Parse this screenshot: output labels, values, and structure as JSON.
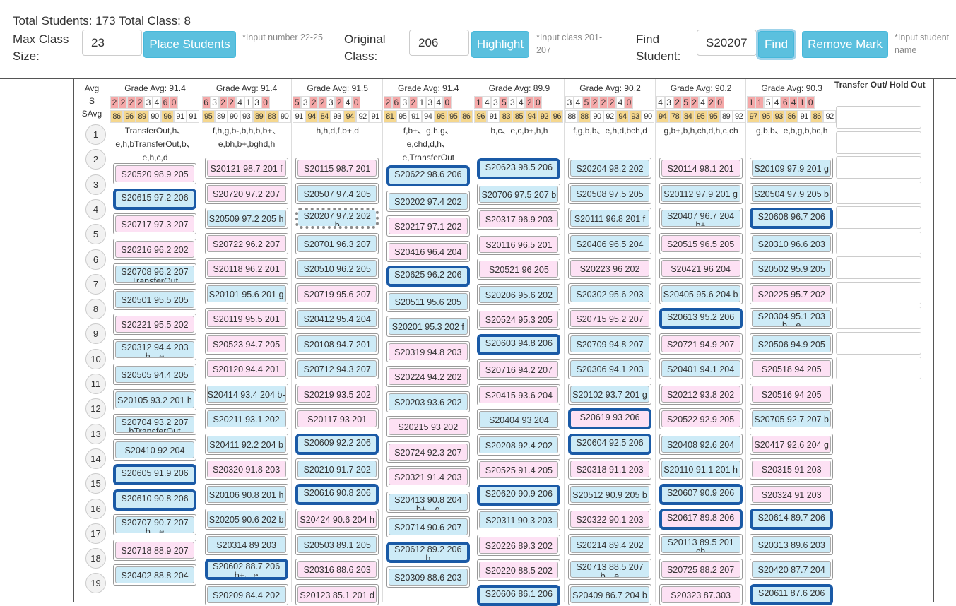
{
  "header": {
    "totals": "Total Students: 173 Total Class: 8",
    "max_class_label": "Max Class Size:",
    "max_class_value": "23",
    "place_button": "Place Students",
    "place_hint": "*Input number 22-25",
    "original_label": "Original Class:",
    "original_value": "206",
    "highlight_button": "Highlight",
    "highlight_hint": "*Input class 201-207",
    "find_label": "Find Student:",
    "find_value": "S20207",
    "find_button": "Find",
    "remove_button": "Remove Mark",
    "find_hint": "*Input student name"
  },
  "rows": {
    "avg_label": "Avg",
    "s_label": "S",
    "savg_label": "SAvg",
    "numbers": [
      "1",
      "2",
      "3",
      "4",
      "5",
      "6",
      "7",
      "8",
      "9",
      "10",
      "11",
      "12",
      "13",
      "14",
      "15",
      "16",
      "17",
      "18",
      "19"
    ]
  },
  "transfer_title": "Transfer Out/ Hold Out",
  "columns": [
    {
      "avg": "Grade Avg: 91.4",
      "s": [
        [
          "2",
          1
        ],
        [
          "2",
          1
        ],
        [
          "2",
          1
        ],
        [
          "2",
          1
        ],
        [
          "3",
          0
        ],
        [
          "4",
          0
        ],
        [
          "6",
          1
        ],
        [
          "0",
          1
        ]
      ],
      "savg": [
        [
          "86",
          1
        ],
        [
          "96",
          1
        ],
        [
          "89",
          1
        ],
        [
          "90",
          0
        ],
        [
          "96",
          1
        ],
        [
          "91",
          0
        ],
        [
          "91",
          0
        ]
      ],
      "tags": "TransferOut,h、e,h,bTransferOut,b、e,h,c,d",
      "students": [
        {
          "t": "S20520 98.9 205",
          "c": "p"
        },
        {
          "t": "S20615 97.2 206",
          "c": "b",
          "hl": true
        },
        {
          "t": "S20717 97.3 207",
          "c": "p"
        },
        {
          "t": "S20216 96.2 202",
          "c": "p"
        },
        {
          "t": "S20708 96.2 207",
          "t2": "TransferOut",
          "c": "b"
        },
        {
          "t": "S20501 95.5 205",
          "c": "b"
        },
        {
          "t": "S20221 95.5 202",
          "c": "p"
        },
        {
          "t": "S20312 94.4 203",
          "t2": "h、e",
          "c": "b"
        },
        {
          "t": "S20505 94.4 205",
          "c": "b"
        },
        {
          "t": "S20105 93.2 201 h",
          "c": "b"
        },
        {
          "t": "S20704 93.2 207",
          "t2": "bTransferOut",
          "c": "b"
        },
        {
          "t": "S20410 92 204",
          "c": "b"
        },
        {
          "t": "S20605 91.9 206",
          "c": "b",
          "hl": true
        },
        {
          "t": "S20610 90.8 206",
          "c": "b",
          "hl": true
        },
        {
          "t": "S20707 90.7 207",
          "t2": "b、e",
          "c": "b"
        },
        {
          "t": "S20718 88.9 207",
          "c": "p"
        },
        {
          "t": "S20402 88.8 204",
          "c": "b"
        }
      ]
    },
    {
      "avg": "Grade Avg: 91.4",
      "s": [
        [
          "6",
          1
        ],
        [
          "3",
          0
        ],
        [
          "2",
          1
        ],
        [
          "2",
          1
        ],
        [
          "4",
          0
        ],
        [
          "1",
          0
        ],
        [
          "3",
          0
        ],
        [
          "0",
          1
        ]
      ],
      "savg": [
        [
          "95",
          1
        ],
        [
          "89",
          0
        ],
        [
          "90",
          0
        ],
        [
          "93",
          0
        ],
        [
          "89",
          1
        ],
        [
          "88",
          1
        ],
        [
          "90",
          0
        ]
      ],
      "tags": "f,h,g,b-,b,h,b,b+、e,bh,b+,bghd,h",
      "students": [
        {
          "t": "S20121 98.7 201 f",
          "c": "p"
        },
        {
          "t": "S20720 97.2 207",
          "c": "p"
        },
        {
          "t": "S20509 97.2 205 h",
          "c": "b"
        },
        {
          "t": "S20722 96.2 207",
          "c": "p"
        },
        {
          "t": "S20118 96.2 201",
          "c": "p"
        },
        {
          "t": "S20101 95.6 201 g",
          "c": "b"
        },
        {
          "t": "S20119 95.5 201",
          "c": "p"
        },
        {
          "t": "S20523 94.7 205",
          "c": "p"
        },
        {
          "t": "S20120 94.4 201",
          "c": "p"
        },
        {
          "t": "S20414 93.4 204 b-",
          "c": "b"
        },
        {
          "t": "S20211 93.1 202",
          "c": "b"
        },
        {
          "t": "S20411 92.2 204 b",
          "c": "b"
        },
        {
          "t": "S20320 91.8 203",
          "c": "p"
        },
        {
          "t": "S20106 90.8 201 h",
          "c": "b"
        },
        {
          "t": "S20205 90.6 202 b",
          "c": "b"
        },
        {
          "t": "S20314 89 203",
          "c": "b"
        },
        {
          "t": "S20602 88.7 206",
          "t2": "b+、e",
          "c": "b",
          "hl": true
        },
        {
          "t": "S20209 84.4 202",
          "c": "b"
        }
      ]
    },
    {
      "avg": "Grade Avg: 91.5",
      "s": [
        [
          "5",
          1
        ],
        [
          "3",
          0
        ],
        [
          "2",
          1
        ],
        [
          "2",
          1
        ],
        [
          "3",
          0
        ],
        [
          "2",
          1
        ],
        [
          "4",
          0
        ],
        [
          "0",
          1
        ]
      ],
      "savg": [
        [
          "91",
          0
        ],
        [
          "94",
          1
        ],
        [
          "84",
          1
        ],
        [
          "93",
          0
        ],
        [
          "94",
          1
        ],
        [
          "92",
          0
        ],
        [
          "91",
          0
        ]
      ],
      "tags": "h,h,d,f,b+,d",
      "students": [
        {
          "t": "S20115 98.7 201",
          "c": "p"
        },
        {
          "t": "S20507 97.4 205",
          "c": "b"
        },
        {
          "t": "S20207 97.2 202",
          "t2": "b",
          "c": "b",
          "dot": true
        },
        {
          "t": "S20701 96.3 207",
          "c": "b"
        },
        {
          "t": "S20510 96.2 205",
          "c": "b"
        },
        {
          "t": "S20719 95.6 207",
          "c": "p"
        },
        {
          "t": "S20412 95.4 204",
          "c": "b"
        },
        {
          "t": "S20108 94.7 201",
          "c": "b"
        },
        {
          "t": "S20712 94.3 207",
          "c": "b"
        },
        {
          "t": "S20219 93.5 202",
          "c": "p"
        },
        {
          "t": "S20117 93 201",
          "c": "p"
        },
        {
          "t": "S20609 92.2 206",
          "c": "b",
          "hl": true
        },
        {
          "t": "S20210 91.7 202",
          "c": "b"
        },
        {
          "t": "S20616 90.8 206",
          "c": "b",
          "hl": true
        },
        {
          "t": "S20424 90.6 204 h",
          "c": "p"
        },
        {
          "t": "S20503 89.1 205",
          "c": "b"
        },
        {
          "t": "S20316 88.6 203",
          "c": "p"
        },
        {
          "t": "S20123 85.1 201 d",
          "c": "p"
        }
      ]
    },
    {
      "avg": "Grade Avg: 91.4",
      "s": [
        [
          "2",
          1
        ],
        [
          "6",
          1
        ],
        [
          "3",
          0
        ],
        [
          "2",
          1
        ],
        [
          "1",
          0
        ],
        [
          "3",
          0
        ],
        [
          "4",
          0
        ],
        [
          "0",
          1
        ]
      ],
      "savg": [
        [
          "81",
          1
        ],
        [
          "95",
          0
        ],
        [
          "91",
          0
        ],
        [
          "94",
          0
        ],
        [
          "95",
          1
        ],
        [
          "95",
          1
        ],
        [
          "86",
          1
        ]
      ],
      "tags": "f,b+、g,h,g、e,chd,d,h、e,TransferOut",
      "students": [
        {
          "t": "S20622 98.6 206",
          "c": "b",
          "hl": true
        },
        {
          "t": "S20202 97.4 202",
          "c": "b"
        },
        {
          "t": "S20217 97.1 202",
          "c": "p"
        },
        {
          "t": "S20416 96.4 204",
          "c": "p"
        },
        {
          "t": "S20625 96.2 206",
          "c": "b",
          "hl": true
        },
        {
          "t": "S20511 95.6 205",
          "c": "b"
        },
        {
          "t": "S20201 95.3 202 f",
          "c": "b"
        },
        {
          "t": "S20319 94.8 203",
          "c": "p"
        },
        {
          "t": "S20224 94.2 202",
          "c": "p"
        },
        {
          "t": "S20203 93.6 202",
          "c": "b"
        },
        {
          "t": "S20215 93 202",
          "c": "p"
        },
        {
          "t": "S20724 92.3 207",
          "c": "p"
        },
        {
          "t": "S20321 91.4 203",
          "c": "p"
        },
        {
          "t": "S20413 90.8 204",
          "t2": "b+、g",
          "c": "b"
        },
        {
          "t": "S20714 90.6 207",
          "c": "b"
        },
        {
          "t": "S20612 89.2 206",
          "t2": "h",
          "c": "b",
          "hl": true
        },
        {
          "t": "S20309 88.6 203",
          "c": "b"
        }
      ]
    },
    {
      "avg": "Grade Avg: 89.9",
      "s": [
        [
          "1",
          1
        ],
        [
          "4",
          0
        ],
        [
          "3",
          0
        ],
        [
          "5",
          1
        ],
        [
          "3",
          0
        ],
        [
          "4",
          0
        ],
        [
          "2",
          1
        ],
        [
          "0",
          1
        ]
      ],
      "savg": [
        [
          "96",
          1
        ],
        [
          "91",
          0
        ],
        [
          "83",
          1
        ],
        [
          "85",
          1
        ],
        [
          "94",
          1
        ],
        [
          "92",
          1
        ],
        [
          "96",
          1
        ]
      ],
      "tags": "b,c、e,c,b+,h,h",
      "students": [
        {
          "t": "S20623 98.5 206",
          "c": "b",
          "hl": true
        },
        {
          "t": "S20706 97.5 207 b",
          "c": "b"
        },
        {
          "t": "S20317 96.9 203",
          "c": "p"
        },
        {
          "t": "S20116 96.5 201",
          "c": "p"
        },
        {
          "t": "S20521 96 205",
          "c": "p"
        },
        {
          "t": "S20206 95.6 202",
          "c": "b"
        },
        {
          "t": "S20524 95.3 205",
          "c": "p"
        },
        {
          "t": "S20603 94.8 206",
          "c": "b",
          "hl": true
        },
        {
          "t": "S20716 94.2 207",
          "c": "p"
        },
        {
          "t": "S20415 93.6 204",
          "c": "p"
        },
        {
          "t": "S20404 93 204",
          "c": "b"
        },
        {
          "t": "S20208 92.4 202",
          "c": "b"
        },
        {
          "t": "S20525 91.4 205",
          "c": "p"
        },
        {
          "t": "S20620 90.9 206",
          "c": "b",
          "hl": true
        },
        {
          "t": "S20311 90.3 203",
          "c": "b"
        },
        {
          "t": "S20226 89.3 202",
          "c": "p"
        },
        {
          "t": "S20220 88.5 202",
          "c": "p"
        },
        {
          "t": "S20606 86.1 206",
          "c": "b",
          "hl": true
        }
      ]
    },
    {
      "avg": "Grade Avg: 90.2",
      "s": [
        [
          "3",
          0
        ],
        [
          "4",
          0
        ],
        [
          "5",
          1
        ],
        [
          "2",
          1
        ],
        [
          "2",
          1
        ],
        [
          "2",
          1
        ],
        [
          "4",
          0
        ],
        [
          "0",
          1
        ]
      ],
      "savg": [
        [
          "88",
          0
        ],
        [
          "88",
          1
        ],
        [
          "90",
          0
        ],
        [
          "92",
          0
        ],
        [
          "94",
          1
        ],
        [
          "93",
          1
        ],
        [
          "90",
          0
        ]
      ],
      "tags": "f,g,b,b、e,h,d,bch,d",
      "students": [
        {
          "t": "S20204 98.2 202",
          "c": "b"
        },
        {
          "t": "S20508 97.5 205",
          "c": "b"
        },
        {
          "t": "S20111 96.8 201 f",
          "c": "b"
        },
        {
          "t": "S20406 96.5 204",
          "c": "b"
        },
        {
          "t": "S20223 96 202",
          "c": "p"
        },
        {
          "t": "S20302 95.6 203",
          "c": "b"
        },
        {
          "t": "S20715 95.2 207",
          "c": "p"
        },
        {
          "t": "S20709 94.8 207",
          "c": "b"
        },
        {
          "t": "S20306 94.1 203",
          "c": "b"
        },
        {
          "t": "S20102 93.7 201 g",
          "c": "b"
        },
        {
          "t": "S20619 93 206",
          "c": "p",
          "hl": true
        },
        {
          "t": "S20604 92.5 206",
          "c": "b",
          "hl": true
        },
        {
          "t": "S20318 91.1 203",
          "c": "p"
        },
        {
          "t": "S20512 90.9 205 b",
          "c": "b"
        },
        {
          "t": "S20322 90.1 203",
          "c": "p"
        },
        {
          "t": "S20214 89.4 202",
          "c": "b"
        },
        {
          "t": "S20713 88.5 207",
          "t2": "b、e",
          "c": "b"
        },
        {
          "t": "S20409 86.7 204 b",
          "c": "b"
        }
      ]
    },
    {
      "avg": "Grade Avg: 90.2",
      "s": [
        [
          "4",
          0
        ],
        [
          "3",
          0
        ],
        [
          "2",
          1
        ],
        [
          "5",
          1
        ],
        [
          "2",
          1
        ],
        [
          "4",
          0
        ],
        [
          "2",
          1
        ],
        [
          "0",
          1
        ]
      ],
      "savg": [
        [
          "94",
          1
        ],
        [
          "78",
          1
        ],
        [
          "84",
          1
        ],
        [
          "95",
          1
        ],
        [
          "95",
          1
        ],
        [
          "89",
          0
        ],
        [
          "92",
          0
        ]
      ],
      "tags": "g,b+,b,h,ch,d,h,c,ch",
      "students": [
        {
          "t": "S20114 98.1 201",
          "c": "p"
        },
        {
          "t": "S20112 97.9 201 g",
          "c": "b"
        },
        {
          "t": "S20407 96.7 204",
          "t2": "b+",
          "c": "b"
        },
        {
          "t": "S20515 96.5 205",
          "c": "p"
        },
        {
          "t": "S20421 96 204",
          "c": "p"
        },
        {
          "t": "S20405 95.6 204 b",
          "c": "b"
        },
        {
          "t": "S20613 95.2 206",
          "c": "b",
          "hl": true
        },
        {
          "t": "S20721 94.9 207",
          "c": "p"
        },
        {
          "t": "S20401 94.1 204",
          "c": "b"
        },
        {
          "t": "S20212 93.8 202",
          "c": "p"
        },
        {
          "t": "S20522 92.9 205",
          "c": "p"
        },
        {
          "t": "S20408 92.6 204",
          "c": "b"
        },
        {
          "t": "S20110 91.1 201 h",
          "c": "b"
        },
        {
          "t": "S20607 90.9 206",
          "c": "b",
          "hl": true
        },
        {
          "t": "S20617 89.8 206",
          "c": "p",
          "hl": true
        },
        {
          "t": "S20113 89.5 201",
          "t2": "ch",
          "c": "b"
        },
        {
          "t": "S20725 88.2 207",
          "c": "p"
        },
        {
          "t": "S20323 87.303",
          "c": "p"
        }
      ]
    },
    {
      "avg": "Grade Avg: 90.3",
      "s": [
        [
          "1",
          1
        ],
        [
          "1",
          1
        ],
        [
          "5",
          0
        ],
        [
          "4",
          0
        ],
        [
          "6",
          1
        ],
        [
          "4",
          1
        ],
        [
          "1",
          1
        ],
        [
          "0",
          1
        ]
      ],
      "savg": [
        [
          "97",
          1
        ],
        [
          "95",
          1
        ],
        [
          "93",
          1
        ],
        [
          "86",
          1
        ],
        [
          "91",
          0
        ],
        [
          "86",
          1
        ],
        [
          "92",
          0
        ]
      ],
      "tags": "g,b,b、e,b,g,b,bc,h",
      "students": [
        {
          "t": "S20109 97.9 201 g",
          "c": "b"
        },
        {
          "t": "S20504 97.9 205 b",
          "c": "b"
        },
        {
          "t": "S20608 96.7 206",
          "c": "b",
          "hl": true
        },
        {
          "t": "S20310 96.6 203",
          "c": "b"
        },
        {
          "t": "S20502 95.9 205",
          "c": "b"
        },
        {
          "t": "S20225 95.7 202",
          "c": "p"
        },
        {
          "t": "S20304 95.1 203",
          "t2": "b、e",
          "c": "b"
        },
        {
          "t": "S20506 94.9 205",
          "c": "b"
        },
        {
          "t": "S20518 94 205",
          "c": "p"
        },
        {
          "t": "S20516 94 205",
          "c": "p"
        },
        {
          "t": "S20705 92.7 207 b",
          "c": "b"
        },
        {
          "t": "S20417 92.6 204 g",
          "c": "p"
        },
        {
          "t": "S20315 91 203",
          "c": "p"
        },
        {
          "t": "S20324 91 203",
          "c": "p"
        },
        {
          "t": "S20614 89.7 206",
          "c": "b",
          "hl": true
        },
        {
          "t": "S20313 89.6 203",
          "c": "b"
        },
        {
          "t": "S20420 87.7 204",
          "c": "b"
        },
        {
          "t": "S20611 87.6 206",
          "c": "b",
          "hl": true
        }
      ]
    }
  ]
}
